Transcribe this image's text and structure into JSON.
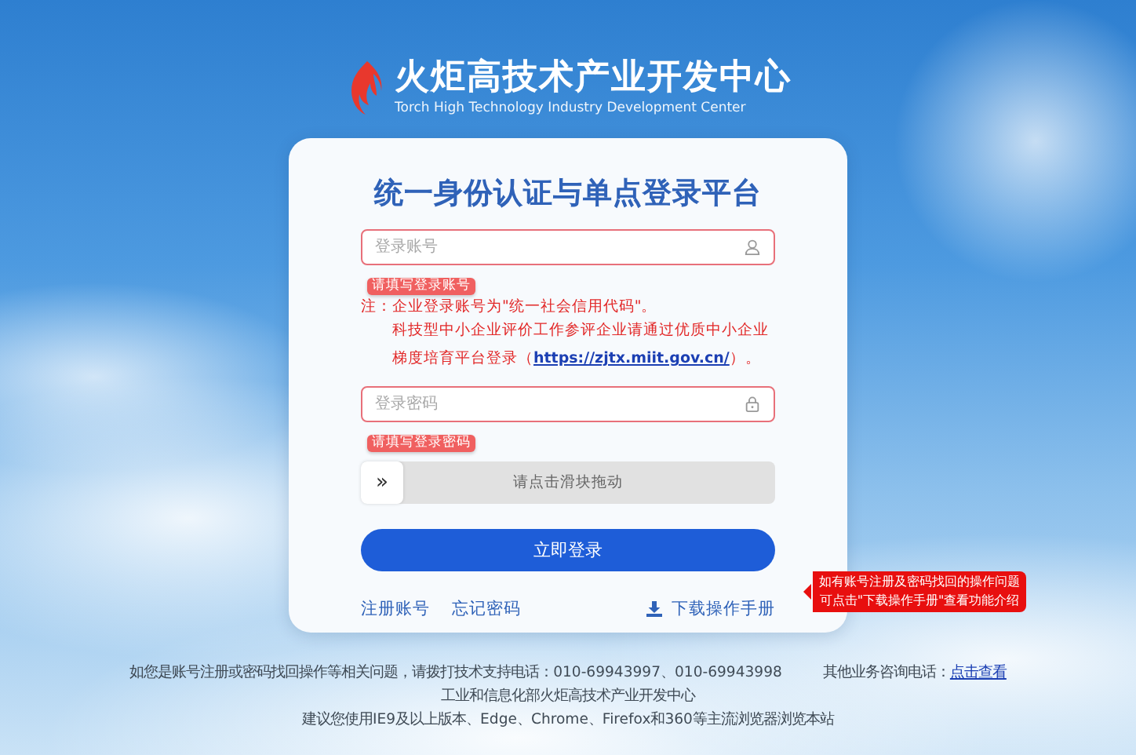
{
  "logo": {
    "title": "火炬高技术产业开发中心",
    "subtitle": "Torch High Technology Industry Development Center"
  },
  "login": {
    "title": "统一身份认证与单点登录平台",
    "fields": [
      {
        "kind": "account",
        "placeholder": "登录账号",
        "invalid": true,
        "error": "请填写登录账号"
      },
      {
        "kind": "password",
        "placeholder": "登录密码",
        "invalid": true,
        "error": "请填写登录密码"
      }
    ],
    "note": "注：企业登录账号为\"统一社会信用代码\"。",
    "notice": {
      "before": "科技型中小企业评价工作参评企业请通过优质中小企业梯度培育平台登录（",
      "link": "https://zjtx.miit.gov.cn/",
      "after": "）。"
    },
    "slider": {
      "handle": "»",
      "hint": "请点击滑块拖动",
      "level": 0
    },
    "submit": "立即登录",
    "links": [
      "注册账号",
      "忘记密码"
    ],
    "download": "下载操作手册",
    "tooltip": [
      "如有账号注册及密码找回的操作问题",
      "可点击\"下载操作手册\"查看功能介绍"
    ]
  },
  "footer": {
    "support": "如您是账号注册或密码找回操作等相关问题，请拨打技术支持电话：010-69943997、010-69943998",
    "other": "其他业务咨询电话：",
    "other_link": "点击查看",
    "org": "工业和信息化部火炬高技术产业开发中心",
    "browser": "建议您使用IE9及以上版本、Edge、Chrome、Firefox和360等主流浏览器浏览本站"
  }
}
